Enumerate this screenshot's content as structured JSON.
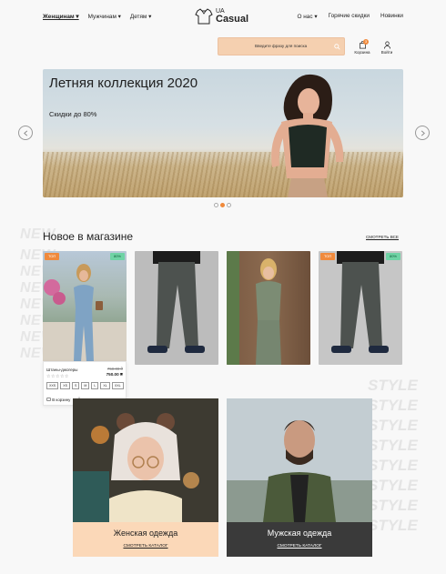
{
  "nav": {
    "left": [
      "Женщинам ▾",
      "Мужчинам ▾",
      "Детям ▾"
    ],
    "right": [
      "О нас ▾",
      "Горячие скидки",
      "Новинки"
    ],
    "logo_top": "UA",
    "logo_bottom": "Casual"
  },
  "search": {
    "placeholder": "Введите фразу для поиска"
  },
  "header_actions": {
    "cart_label": "Корзина",
    "cart_count": "3",
    "login_label": "Войти"
  },
  "hero": {
    "title": "Летняя коллекция 2020",
    "subtitle": "Скидки до 80%",
    "slides": 3,
    "active_slide": 2
  },
  "new_section": {
    "title": "Новое в магазине",
    "see_all": "СМОТРЕТЬ ВСЕ",
    "bg_word": "NEW",
    "cards": [
      {
        "tag_left": "ТОП",
        "tag_right": "80%"
      },
      {
        "tag_left": "",
        "tag_right": ""
      },
      {
        "tag_left": "",
        "tag_right": ""
      },
      {
        "tag_left": "ТОП",
        "tag_right": "80%"
      }
    ],
    "product": {
      "name": "Штаны-джогеры",
      "stars": "☆☆☆☆☆",
      "old_price": "750.00 ₴",
      "new_price": "750.00 ₴",
      "sizes": [
        "XXS",
        "XS",
        "S",
        "M",
        "L",
        "XL",
        "XXL"
      ],
      "add_to_cart": "В корзину",
      "one_click": "В один клик"
    }
  },
  "style_word": "STYLE",
  "categories": [
    {
      "title": "Женская одежда",
      "link": "СМОТРЕТЬ КАТАЛОГ"
    },
    {
      "title": "Мужская одежда",
      "link": "СМОТРЕТЬ КАТАЛОГ"
    }
  ],
  "colors": {
    "accent": "#f08a3c",
    "peach": "#fbd8b8",
    "badge_green": "#6fd3a5",
    "dark": "#3a3a3a"
  }
}
